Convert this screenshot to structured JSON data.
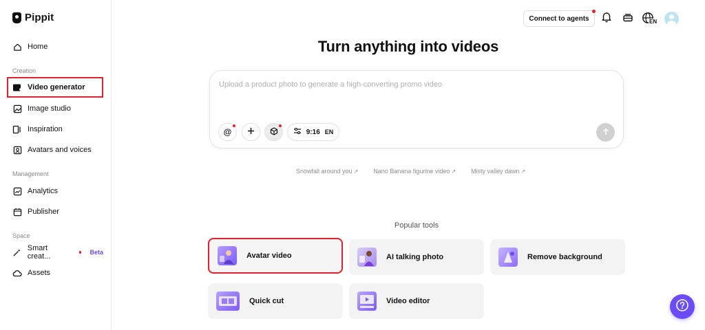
{
  "app": {
    "name": "Pippit"
  },
  "sidebar": {
    "home": "Home",
    "sections": {
      "creation": "Creation",
      "management": "Management",
      "space": "Space"
    },
    "creation_items": [
      {
        "label": "Video generator",
        "icon": "video-generator-icon",
        "active": true
      },
      {
        "label": "Image studio",
        "icon": "image-studio-icon"
      },
      {
        "label": "Inspiration",
        "icon": "inspiration-icon"
      },
      {
        "label": "Avatars and voices",
        "icon": "avatar-voice-icon"
      }
    ],
    "management_items": [
      {
        "label": "Analytics",
        "icon": "analytics-icon"
      },
      {
        "label": "Publisher",
        "icon": "calendar-icon"
      }
    ],
    "space_items": [
      {
        "label": "Smart creat...",
        "icon": "magic-wand-icon",
        "badge": "Beta"
      },
      {
        "label": "Assets",
        "icon": "cloud-icon"
      }
    ]
  },
  "topbar": {
    "connect_label": "Connect to agents",
    "language": "EN"
  },
  "main": {
    "headline": "Turn anything into videos",
    "prompt": {
      "placeholder": "Upload a product photo to generate a high-converting promo video",
      "ratio": "9:16",
      "language": "EN"
    },
    "suggestions": [
      "Snowfall around you",
      "Nano Banana figurine video",
      "Misty valley dawn"
    ],
    "popular_title": "Popular tools",
    "tools": [
      {
        "label": "Avatar video",
        "highlighted": true
      },
      {
        "label": "AI talking photo"
      },
      {
        "label": "Remove background"
      },
      {
        "label": "Quick cut"
      },
      {
        "label": "Video editor"
      }
    ]
  },
  "colors": {
    "accent": "#6b4cf6",
    "highlight_border": "#e0202a",
    "card_bg": "#f3f3f3"
  }
}
